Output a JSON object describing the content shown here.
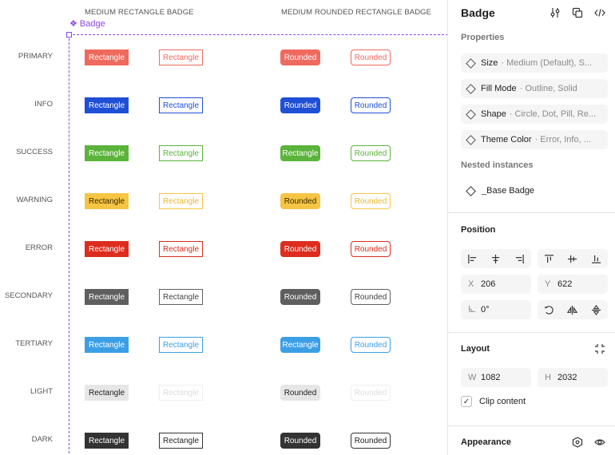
{
  "canvas": {
    "col_header_rect": "MEDIUM RECTANGLE BADGE",
    "col_header_rounded": "MEDIUM ROUNDED RECTANGLE BADGE",
    "frame_label": "Badge",
    "frame_color": "#8a45e6",
    "rows": [
      {
        "label": "PRIMARY",
        "solid_bg": "#ef6a5e",
        "solid_fg": "#ffffff",
        "outline_border": "#ef6a5e",
        "outline_fg": "#ef6a5e",
        "outline_bg": "#ffffff",
        "badges": [
          "Rectangle",
          "Rectangle",
          "Rounded",
          "Rounded"
        ]
      },
      {
        "label": "INFO",
        "solid_bg": "#1f4fd6",
        "solid_fg": "#ffffff",
        "outline_border": "#1f4fd6",
        "outline_fg": "#1f4fd6",
        "outline_bg": "#ffffff",
        "badges": [
          "Rectangle",
          "Rectangle",
          "Rounded",
          "Rounded"
        ]
      },
      {
        "label": "SUCCESS",
        "solid_bg": "#5bb33b",
        "solid_fg": "#ffffff",
        "outline_border": "#5bb33b",
        "outline_fg": "#5bb33b",
        "outline_bg": "#ffffff",
        "badges": [
          "Rectangle",
          "Rectangle",
          "Rectangle",
          "Rounded"
        ]
      },
      {
        "label": "WARNING",
        "solid_bg": "#f6c544",
        "solid_fg": "#3a2a00",
        "outline_border": "#f6c544",
        "outline_fg": "#e8b830",
        "outline_bg": "#ffffff",
        "badges": [
          "Rectangle",
          "Rectangle",
          "Rounded",
          "Rounded"
        ]
      },
      {
        "label": "ERROR",
        "solid_bg": "#dc2d1e",
        "solid_fg": "#ffffff",
        "outline_border": "#dc2d1e",
        "outline_fg": "#dc2d1e",
        "outline_bg": "#ffffff",
        "badges": [
          "Rectangle",
          "Rectangle",
          "Rounded",
          "Rounded"
        ]
      },
      {
        "label": "SECONDARY",
        "solid_bg": "#5f5f5f",
        "solid_fg": "#ffffff",
        "outline_border": "#5f5f5f",
        "outline_fg": "#444444",
        "outline_bg": "#ffffff",
        "badges": [
          "Rectangle",
          "Rectangle",
          "Rounded",
          "Rounded"
        ]
      },
      {
        "label": "TERTIARY",
        "solid_bg": "#3c9fe6",
        "solid_fg": "#ffffff",
        "outline_border": "#3c9fe6",
        "outline_fg": "#3c9fe6",
        "outline_bg": "#ffffff",
        "badges": [
          "Rectangle",
          "Rectangle",
          "Rectangle",
          "Rounded"
        ]
      },
      {
        "label": "LIGHT",
        "solid_bg": "#e6e6e6",
        "solid_fg": "#222222",
        "outline_border": "#eeeeee",
        "outline_fg": "#dddddd",
        "outline_bg": "#ffffff",
        "badges": [
          "Rectangle",
          "Rectangle",
          "Rounded",
          "Rounded"
        ]
      },
      {
        "label": "DARK",
        "solid_bg": "#333333",
        "solid_fg": "#ffffff",
        "outline_border": "#333333",
        "outline_fg": "#222222",
        "outline_bg": "#ffffff",
        "badges": [
          "Rectangle",
          "Rectangle",
          "Rounded",
          "Rounded"
        ]
      }
    ]
  },
  "panel": {
    "title": "Badge",
    "top_icons": [
      "sliders-icon",
      "component-swap-icon",
      "code-icon"
    ],
    "properties_label": "Properties",
    "properties": [
      {
        "name": "Size",
        "value": "· Medium (Default), S..."
      },
      {
        "name": "Fill Mode",
        "value": "· Outline, Solid"
      },
      {
        "name": "Shape",
        "value": "· Circle, Dot, Pill, Re..."
      },
      {
        "name": "Theme Color",
        "value": "· Error, Info, ..."
      }
    ],
    "nested_label": "Nested instances",
    "nested_item": "_Base Badge",
    "position_label": "Position",
    "x_label": "X",
    "x_value": "206",
    "y_label": "Y",
    "y_value": "622",
    "rotation_value": "0°",
    "layout_label": "Layout",
    "w_label": "W",
    "w_value": "1082",
    "h_label": "H",
    "h_value": "2032",
    "clip_label": "Clip content",
    "clip_checked_glyph": "✓",
    "appearance_label": "Appearance"
  }
}
